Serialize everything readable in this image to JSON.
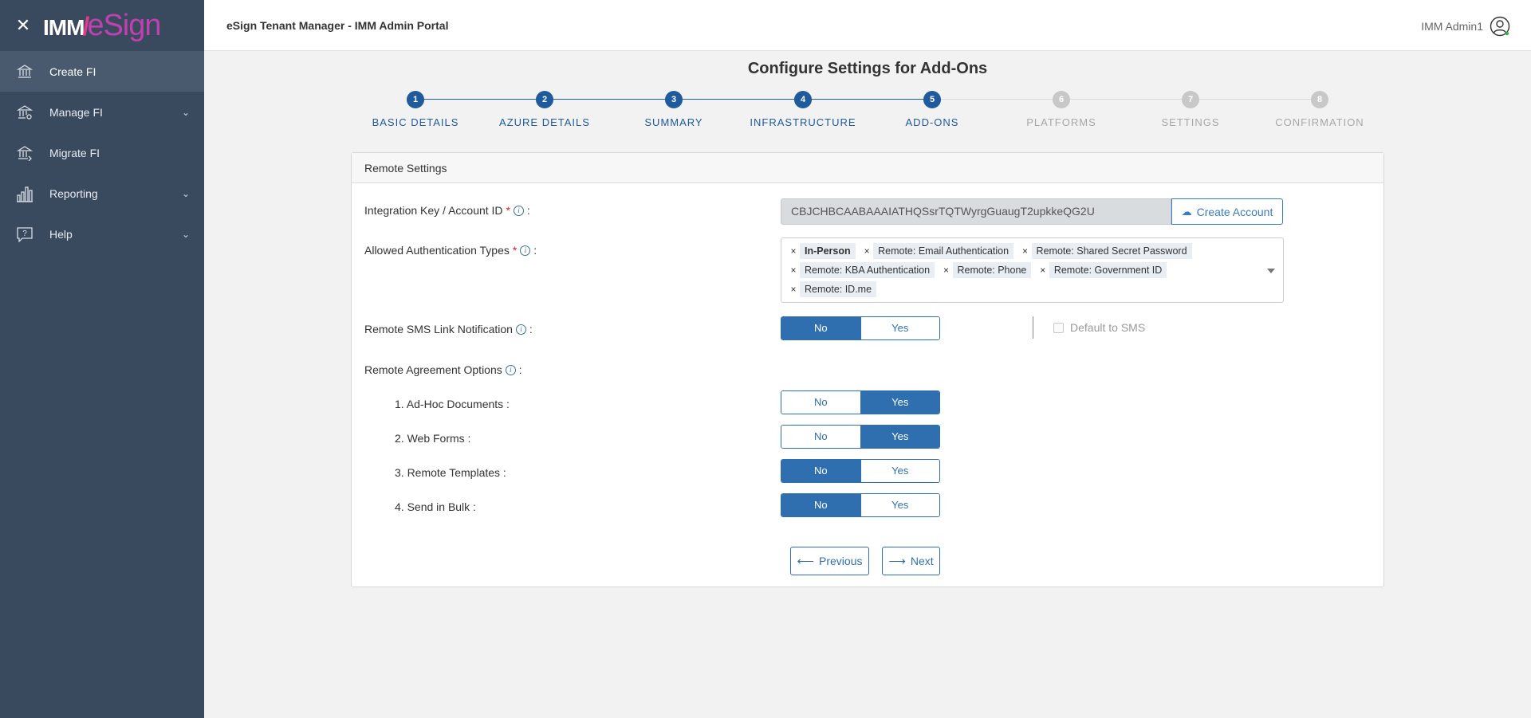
{
  "sidebar": {
    "logo_imm": "IMM",
    "logo_esign": "eSign",
    "items": [
      {
        "label": "Create FI",
        "icon": "bank-icon"
      },
      {
        "label": "Manage FI",
        "icon": "bank-settings-icon"
      },
      {
        "label": "Migrate FI",
        "icon": "bank-migrate-icon"
      },
      {
        "label": "Reporting",
        "icon": "bar-chart-icon"
      },
      {
        "label": "Help",
        "icon": "help-icon"
      }
    ]
  },
  "header": {
    "title": "eSign Tenant Manager - IMM Admin Portal",
    "user_name": "IMM Admin1"
  },
  "page": {
    "title": "Configure Settings for Add-Ons"
  },
  "steps": [
    {
      "number": "1",
      "label": "BASIC DETAILS",
      "state": "done"
    },
    {
      "number": "2",
      "label": "AZURE DETAILS",
      "state": "done"
    },
    {
      "number": "3",
      "label": "SUMMARY",
      "state": "done"
    },
    {
      "number": "4",
      "label": "INFRASTRUCTURE",
      "state": "done"
    },
    {
      "number": "5",
      "label": "ADD-ONS",
      "state": "active"
    },
    {
      "number": "6",
      "label": "PLATFORMS",
      "state": "pending"
    },
    {
      "number": "7",
      "label": "SETTINGS",
      "state": "pending"
    },
    {
      "number": "8",
      "label": "CONFIRMATION",
      "state": "pending"
    }
  ],
  "colors": {
    "primary": "#1e5a9c",
    "pending": "#c8c8c8",
    "sidebar": "#3a4a5e"
  },
  "card": {
    "title": "Remote Settings",
    "integration_key_label": "Integration Key / Account ID",
    "integration_key_value": "CBJCHBCAABAAAIATHQSsrTQTWyrgGuaugT2upkkeQG2U",
    "create_account_label": "Create Account",
    "auth_types_label": "Allowed Authentication Types",
    "auth_types": [
      "In-Person",
      "Remote: Email Authentication",
      "Remote: Shared Secret Password",
      "Remote: KBA Authentication",
      "Remote: Phone",
      "Remote: Government ID",
      "Remote: ID.me"
    ],
    "sms_label": "Remote SMS Link Notification",
    "sms_value": "No",
    "default_sms_label": "Default to SMS",
    "agreement_label": "Remote Agreement Options",
    "options": [
      {
        "label": "1. Ad-Hoc Documents :",
        "value": "Yes"
      },
      {
        "label": "2. Web Forms :",
        "value": "Yes"
      },
      {
        "label": "3. Remote Templates :",
        "value": "No"
      },
      {
        "label": "4. Send in Bulk :",
        "value": "No"
      }
    ],
    "no_label": "No",
    "yes_label": "Yes",
    "colon": ":",
    "required_mark": "*",
    "info_glyph": "i",
    "previous_label": "Previous",
    "next_label": "Next"
  }
}
